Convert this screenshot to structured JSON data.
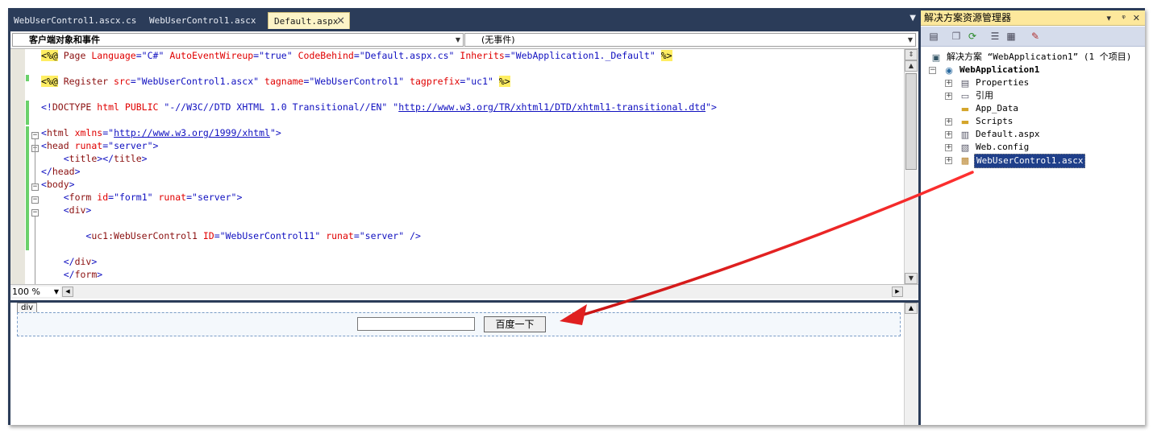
{
  "tabs": [
    {
      "label": "WebUserControl1.ascx.cs",
      "active": false
    },
    {
      "label": "WebUserControl1.ascx",
      "active": false
    },
    {
      "label": "Default.aspx",
      "active": true
    }
  ],
  "nav": {
    "object_combo": "客户端对象和事件",
    "event_combo": "(无事件)"
  },
  "code_lines": [
    "<%@ Page Language=\"C#\" AutoEventWireup=\"true\" CodeBehind=\"Default.aspx.cs\" Inherits=\"WebApplication1._Default\" %>",
    "",
    "<%@ Register src=\"WebUserControl1.ascx\" tagname=\"WebUserControl1\" tagprefix=\"uc1\" %>",
    "",
    "<!DOCTYPE html PUBLIC \"-//W3C//DTD XHTML 1.0 Transitional//EN\" \"http://www.w3.org/TR/xhtml1/DTD/xhtml1-transitional.dtd\">",
    "",
    "<html xmlns=\"http://www.w3.org/1999/xhtml\">",
    "<head runat=\"server\">",
    "    <title></title>",
    "</head>",
    "<body>",
    "    <form id=\"form1\" runat=\"server\">",
    "    <div>",
    "",
    "        <uc1:WebUserControl1 ID=\"WebUserControl11\" runat=\"server\" />",
    "",
    "    </div>",
    "    </form>"
  ],
  "zoom": "100 %",
  "design": {
    "div_tag": "div",
    "button_label": "百度一下"
  },
  "solution": {
    "title": "解决方案资源管理器",
    "title_controls": [
      "▾",
      "ᵠ",
      "✕"
    ],
    "root": "解决方案 “WebApplication1” (1 个项目)",
    "project": "WebApplication1",
    "items": [
      {
        "label": "Properties",
        "icon": "properties-icon",
        "expandable": true
      },
      {
        "label": "引用",
        "icon": "references-icon",
        "expandable": true
      },
      {
        "label": "App_Data",
        "icon": "folder-icon",
        "expandable": false
      },
      {
        "label": "Scripts",
        "icon": "folder-icon",
        "expandable": true
      },
      {
        "label": "Default.aspx",
        "icon": "aspx-file-icon",
        "expandable": true
      },
      {
        "label": "Web.config",
        "icon": "config-file-icon",
        "expandable": true
      },
      {
        "label": "WebUserControl1.ascx",
        "icon": "ascx-file-icon",
        "expandable": true,
        "selected": true
      }
    ]
  },
  "colors": {
    "ide_frame": "#2b3c59",
    "active_tab": "#fcf4c7",
    "title_bar": "#fde89c",
    "selection": "#1f3f8a",
    "annotation_arrow": "#e02020",
    "directive_highlight": "#ffee62"
  }
}
